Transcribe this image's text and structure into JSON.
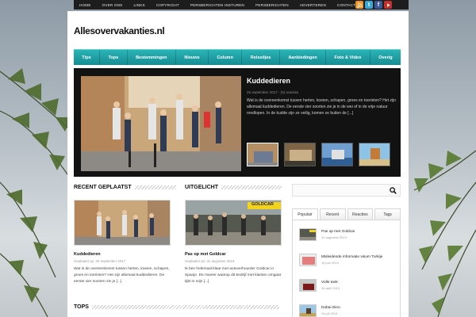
{
  "top_nav": {
    "links": [
      "HOME",
      "OVER ONS",
      "LINKS",
      "COPYRIGHT",
      "PERSBERICHTEN INSTUREN",
      "PERSBERICHTEN",
      "ADVERTEREN",
      "CONTACT"
    ]
  },
  "social": {
    "rss": "rss-icon",
    "twitter": "twitter-icon",
    "facebook": "facebook-icon",
    "youtube": "youtube-icon"
  },
  "site": {
    "logo": "Allesovervakanties.nl"
  },
  "category_menu": [
    "Tips",
    "Tops",
    "Bestemmingen",
    "Nieuws",
    "Column",
    "Reisstijes",
    "Aanbiedingen",
    "Foto & Video",
    "Overig"
  ],
  "featured": {
    "title": "Kuddedieren",
    "meta": "25 september 2017 - (0) reacties",
    "excerpt": "Wat is de overeenkomst tussen herten, koeien, schapen, groes en toeristen? Het zijn allemaal kuddedieren. De eerste vier soorten zie je in de wei of in de vrije natuur rondlopen. In de kudde zijn ze veilig, komen ze buiten de [...]"
  },
  "sections": {
    "recent": "RECENT GEPLAATST",
    "featured": "UITGELICHT",
    "tops": "TOPS"
  },
  "recent_post": {
    "title": "Kuddedieren",
    "meta": "Geplaatst op: 25 september 2017",
    "excerpt": "Wat is de overeenkomst tussen herten, koeien, schapen, groes en toeristen? Het zijn allemaal kuddedieren. De eerste vier soorten zie je [...]"
  },
  "featured_post": {
    "title": "Pas op met Goldcar",
    "meta": "Geplaatst op: 31 augustus 2013",
    "excerpt": "Ik ben helemaal klaar met autoverhuurder Goldcar in Spanje. De manier waarop dit bedrijf met klanten omgaat tijkt in mijn [...]"
  },
  "goldcar_sign": "GOLDCAR",
  "sidebar": {
    "search_placeholder": "",
    "tabs": [
      "Populair",
      "Recent",
      "Reacties",
      "Tags"
    ],
    "items": [
      {
        "title": "Pas op met Goldcar",
        "date": "31 augustus 2013"
      },
      {
        "title": "Misleidende informatie visum Turkije",
        "date": "16 juni 2014"
      },
      {
        "title": "Volle tank",
        "date": "16 april 2013"
      },
      {
        "title": "Dubai Dino",
        "date": "14 juli 2014"
      }
    ]
  },
  "colors": {
    "menu_accent": "#1fa3a7",
    "topbar": "#1d1d1d",
    "slider_bg": "#121212"
  }
}
